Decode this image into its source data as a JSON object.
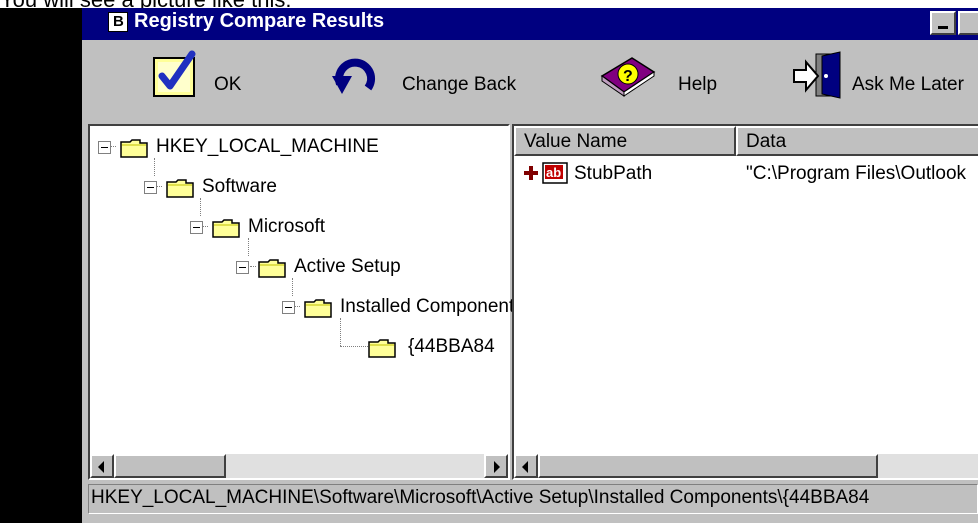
{
  "caption": "You will see a picture like this:",
  "window": {
    "title": "Registry Compare Results",
    "app_icon_letter": "B"
  },
  "toolbar": {
    "ok_label": "OK",
    "change_back_label": "Change Back",
    "help_label": "Help",
    "ask_me_later_label": "Ask Me Later"
  },
  "tree": {
    "items": [
      {
        "label": "HKEY_LOCAL_MACHINE"
      },
      {
        "label": "Software"
      },
      {
        "label": "Microsoft"
      },
      {
        "label": "Active Setup"
      },
      {
        "label": "Installed Components"
      },
      {
        "label": "{44BBA84"
      }
    ]
  },
  "list": {
    "columns": {
      "value_name": "Value Name",
      "data": "Data"
    },
    "rows": [
      {
        "name": "StubPath",
        "data": "\"C:\\Program Files\\Outlook"
      }
    ]
  },
  "status_bar": "HKEY_LOCAL_MACHINE\\Software\\Microsoft\\Active Setup\\Installed Components\\{44BBA84",
  "colors": {
    "title_bar": "#000080",
    "window_face": "#c0c0c0",
    "folder": "#ffff99",
    "add_marker": "#800000"
  }
}
